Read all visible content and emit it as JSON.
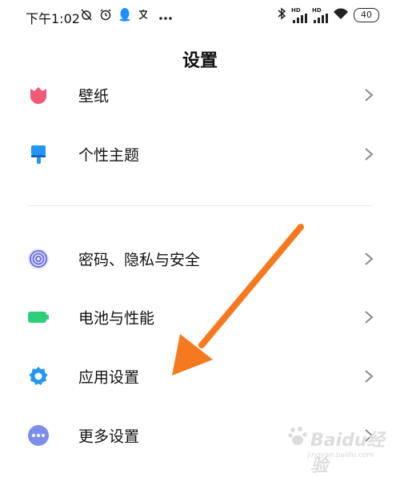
{
  "status_bar": {
    "time": "下午1:02",
    "battery": "40",
    "network_tag": "HD"
  },
  "header": {
    "title": "设置"
  },
  "settings": [
    {
      "label": "壁纸",
      "icon": "wallpaper-icon",
      "color": "#f05a78"
    },
    {
      "label": "个性主题",
      "icon": "theme-brush-icon",
      "color": "#2196f3"
    },
    {
      "label": "密码、隐私与安全",
      "icon": "fingerprint-icon",
      "color": "#6e6ee8"
    },
    {
      "label": "电池与性能",
      "icon": "battery-icon",
      "color": "#2ecf7a"
    },
    {
      "label": "应用设置",
      "icon": "app-settings-gear-icon",
      "color": "#2196f3"
    },
    {
      "label": "更多设置",
      "icon": "more-dots-icon",
      "color": "#7b8fe8"
    }
  ],
  "annotation": {
    "arrow_color": "#f57a1f"
  },
  "watermark": {
    "brand": "Baidu经验",
    "url": "jingyan.baidu.com"
  }
}
